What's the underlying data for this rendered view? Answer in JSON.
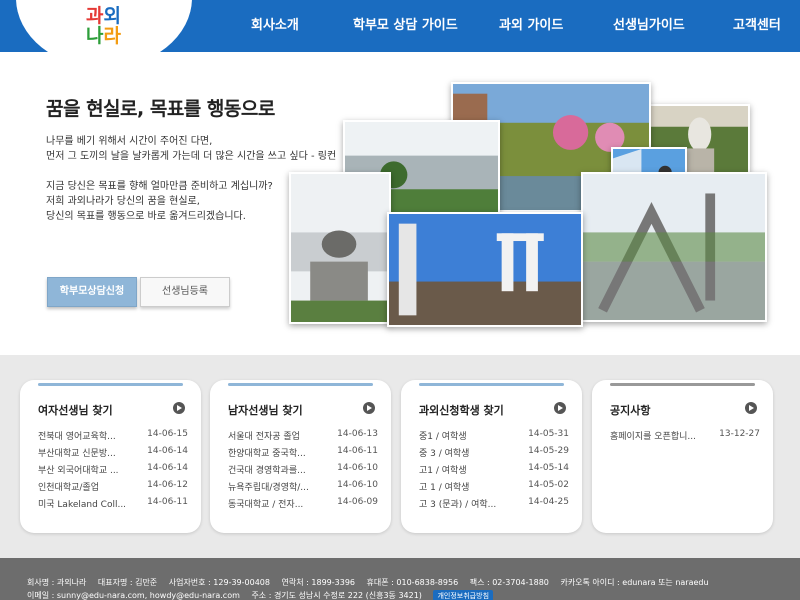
{
  "logo": {
    "char1": "과",
    "char2": "외",
    "char3": "나",
    "char4": "라"
  },
  "nav": [
    "회사소개",
    "학부모 상담 가이드",
    "과외 가이드",
    "선생님가이드",
    "고객센터"
  ],
  "hero": {
    "title": "꿈을 현실로, 목표를 행동으로",
    "p1": "나무를 베기 위해서 시간이 주어진 다면,",
    "p2": "먼저 그 도끼의 날을 날카롭게 가는데 더 많은 시간을 쓰고 싶다 - 링컨",
    "p3": "지금 당신은 목표를 향해 얼마만큼 준비하고 계십니까?",
    "p4": "저희 과외나라가 당신의 꿈을 현실로,",
    "p5": "당신의 목표를 행동으로 바로 옮겨드리겠습니다.",
    "btn_consult": "학부모상담신청",
    "btn_teacher": "선생님등록"
  },
  "boards": [
    {
      "title": "여자선생님 찾기",
      "items": [
        {
          "t": "전북대 영어교육학...",
          "d": "14-06-15"
        },
        {
          "t": "부산대학교 신문방...",
          "d": "14-06-14"
        },
        {
          "t": "부산 외국어대학교 ...",
          "d": "14-06-14"
        },
        {
          "t": "인천대학교/졸업",
          "d": "14-06-12"
        },
        {
          "t": "미국 Lakeland Coll...",
          "d": "14-06-11"
        }
      ]
    },
    {
      "title": "남자선생님 찾기",
      "items": [
        {
          "t": "서울대 전자공 졸업",
          "d": "14-06-13"
        },
        {
          "t": "한양대학교 중국학...",
          "d": "14-06-11"
        },
        {
          "t": "건국대 경영학과를...",
          "d": "14-06-10"
        },
        {
          "t": "뉴욕주립대/경영학/...",
          "d": "14-06-10"
        },
        {
          "t": "동국대학교 / 전자...",
          "d": "14-06-09"
        }
      ]
    },
    {
      "title": "과외신청학생 찾기",
      "items": [
        {
          "t": "중1 / 여학생",
          "d": "14-05-31"
        },
        {
          "t": "중 3 / 여학생",
          "d": "14-05-29"
        },
        {
          "t": "고1 / 여학생",
          "d": "14-05-14"
        },
        {
          "t": "고 1 / 여학생",
          "d": "14-05-02"
        },
        {
          "t": "고 3 (문과) / 여학...",
          "d": "14-04-25"
        }
      ]
    },
    {
      "title": "공지사항",
      "items": [
        {
          "t": "홈페이지를 오픈합니...",
          "d": "13-12-27"
        }
      ]
    }
  ],
  "footer": {
    "company": "회사명 : 과외나라",
    "ceo": "대표자명 : 김만준",
    "bizno": "사업자번호 : 129-39-00408",
    "tel": "연락처 : 1899-3396",
    "mobile": "휴대폰 : 010-6838-8956",
    "fax": "팩스 : 02-3704-1880",
    "kakao": "카카오톡 아이디 : edunara 또는 naraedu",
    "email": "이메일 : sunny@edu-nara.com, howdy@edu-nara.com",
    "address": "주소 : 경기도 성남시 수정로 222 (신흥3동 3421)",
    "privacy": "개인정보취급방침"
  },
  "colors": {
    "brand": "#1a6cc0",
    "accent": "#8fb6d8"
  }
}
